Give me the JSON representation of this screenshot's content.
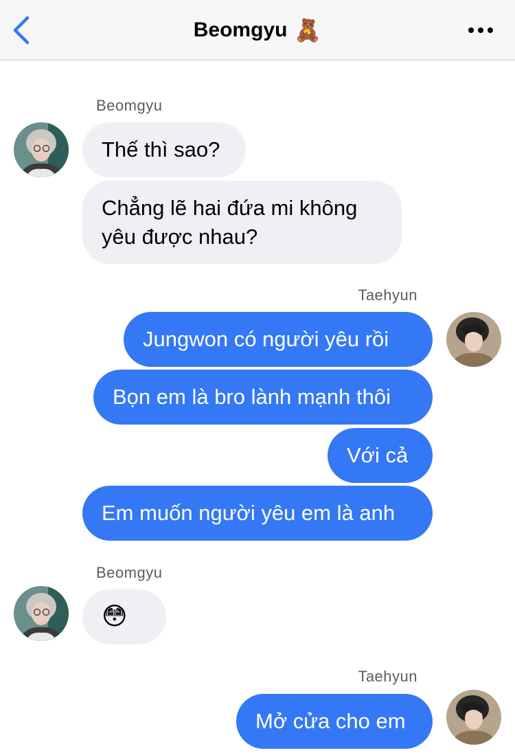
{
  "header": {
    "title": "Beomgyu",
    "title_emoji": "🧸",
    "back_icon": "chevron-left-icon",
    "more_icon": "ellipsis-icon",
    "accent": "#3478f6"
  },
  "colors": {
    "incoming_bubble": "#efeff4",
    "outgoing_bubble": "#3478f6",
    "header_bg": "#f7f7f7"
  },
  "chat": {
    "groups": [
      {
        "sender": "Beomgyu",
        "direction": "incoming",
        "messages": [
          "Thế thì sao?",
          "Chẳng lẽ hai đứa mi không\nyêu được nhau?"
        ]
      },
      {
        "sender": "Taehyun",
        "direction": "outgoing",
        "messages": [
          "Jungwon có người yêu rồi",
          "Bọn em là bro lành mạnh thôi",
          "Với cả",
          "Em muốn người yêu em là anh"
        ]
      },
      {
        "sender": "Beomgyu",
        "direction": "incoming",
        "messages": [
          "😳"
        ]
      },
      {
        "sender": "Taehyun",
        "direction": "outgoing",
        "messages": [
          "Mở cửa cho em"
        ]
      }
    ]
  }
}
